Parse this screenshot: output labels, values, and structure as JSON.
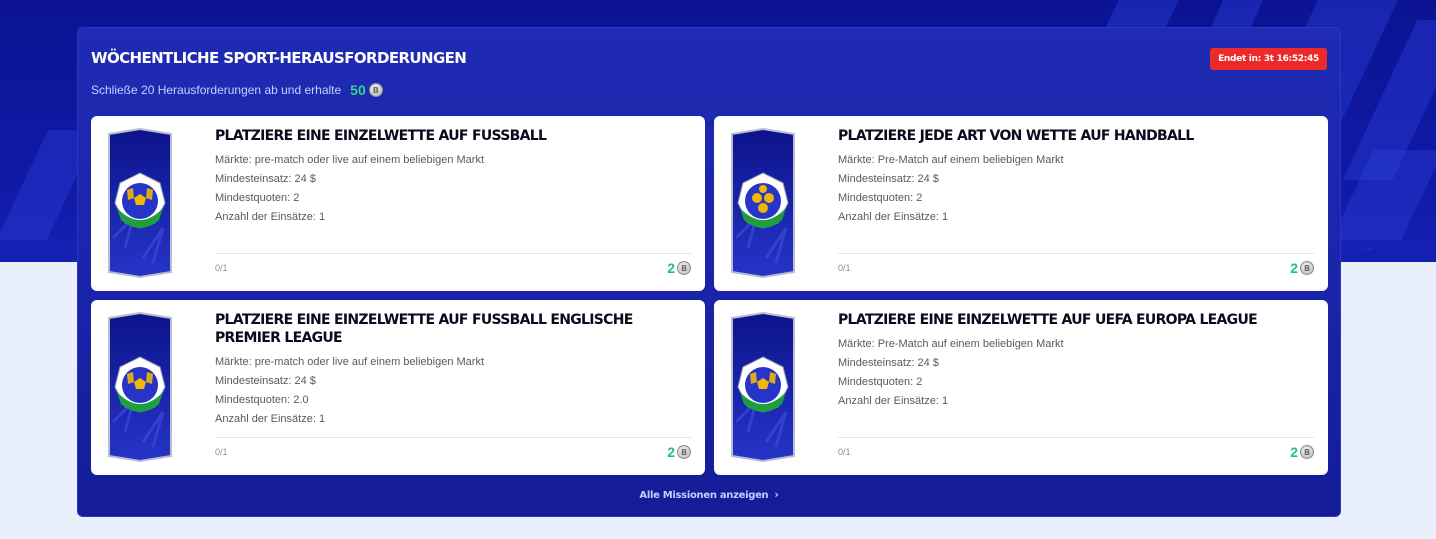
{
  "panel": {
    "title": "Wöchentliche Sport-Herausforderungen",
    "subtitle": "Schließe 20 Herausforderungen ab und erhalte",
    "reward": "50",
    "coin_symbol": "B",
    "timer": "Endet in: 3t 16:52:45"
  },
  "cards": [
    {
      "title": "Platziere eine Einzelwette auf Fussball",
      "lines": [
        "Märkte:  pre-match oder live auf einem beliebigen Markt",
        "Mindesteinsatz: 24 $",
        "Mindestquoten: 2",
        "Anzahl der Einsätze: 1"
      ],
      "progress": "0/1",
      "reward": "2",
      "coin_symbol": "B",
      "icon": "soccer-ball-icon"
    },
    {
      "title": "Platziere jede Art von Wette auf Handball",
      "lines": [
        "Märkte:  Pre-Match auf einem beliebigen Markt",
        "Mindesteinsatz: 24 $",
        "Mindestquoten: 2",
        "Anzahl der Einsätze: 1"
      ],
      "progress": "0/1",
      "reward": "2",
      "coin_symbol": "B",
      "icon": "handball-icon"
    },
    {
      "title": "Platziere eine Einzelwette auf Fussball Englische Premier League",
      "lines": [
        "Märkte:  pre-match oder live auf einem beliebigen Markt",
        "Mindesteinsatz: 24 $",
        "Mindestquoten: 2.0",
        "Anzahl der Einsätze: 1"
      ],
      "progress": "0/1",
      "reward": "2",
      "coin_symbol": "B",
      "icon": "soccer-ball-icon"
    },
    {
      "title": "Platziere eine Einzelwette auf UEFA Europa League",
      "lines": [
        "Märkte:  Pre-Match auf einem beliebigen Markt",
        "Mindesteinsatz: 24 $",
        "Mindestquoten: 2",
        "Anzahl der Einsätze: 1"
      ],
      "progress": "0/1",
      "reward": "2",
      "coin_symbol": "B",
      "icon": "soccer-ball-icon"
    }
  ],
  "footer": {
    "show_all_label": "Alle Missionen anzeigen",
    "chevron": "›"
  },
  "colors": {
    "panel_bg": "#1a24a8",
    "timer_bg": "#ec2a2a",
    "reward_green": "#1ec27a",
    "badge_green": "#1f9e3f",
    "badge_yellow": "#f2b705"
  }
}
